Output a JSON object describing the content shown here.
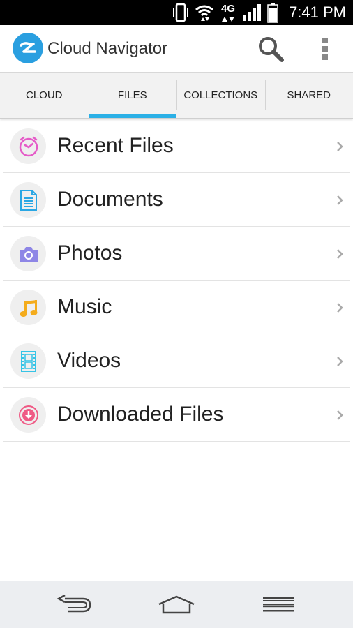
{
  "status_bar": {
    "network": "4G",
    "time": "7:41 PM"
  },
  "app_bar": {
    "title": "Cloud Navigator",
    "logo_icon": "cloud-navigator-logo",
    "actions": [
      "search-icon",
      "overflow-menu-icon"
    ]
  },
  "tabs": [
    {
      "label": "CLOUD",
      "active": false
    },
    {
      "label": "FILES",
      "active": true
    },
    {
      "label": "COLLECTIONS",
      "active": false
    },
    {
      "label": "SHARED",
      "active": false
    }
  ],
  "items": [
    {
      "label": "Recent Files",
      "icon": "clock-icon",
      "color": "#e55cc8"
    },
    {
      "label": "Documents",
      "icon": "document-icon",
      "color": "#2aa7e4"
    },
    {
      "label": "Photos",
      "icon": "camera-icon",
      "color": "#8e86e6"
    },
    {
      "label": "Music",
      "icon": "music-note-icon",
      "color": "#f4ac1c"
    },
    {
      "label": "Videos",
      "icon": "film-icon",
      "color": "#36c4e6"
    },
    {
      "label": "Downloaded Files",
      "icon": "download-icon",
      "color": "#ef5a85"
    }
  ],
  "colors": {
    "accent": "#2bb0e6",
    "logo": "#2a9fe0",
    "status_bar": "#000000",
    "nav_bar": "#eceef1"
  },
  "nav_bar": [
    "back-icon",
    "home-icon",
    "menu-icon"
  ]
}
